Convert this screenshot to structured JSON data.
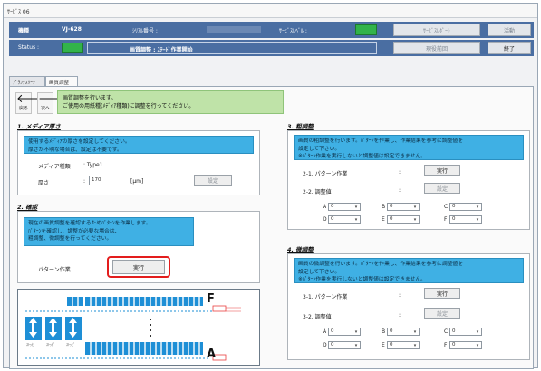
{
  "window": {
    "title": "ｻｰﾋﾞｽ 06"
  },
  "header": {
    "model_label": "機種",
    "model_value": "VJ-628",
    "serial_label": "ｼﾘｱﾙ番号 :",
    "service_level_label": "ｻｰﾋﾞｽﾚﾍﾞﾙ :",
    "status_label": "Status :",
    "status_text": "画質調整 : ｽﾃｰﾄﾞ作業開始",
    "btn_top1": "ｻｰﾋﾞｽﾚﾎﾟｰﾄ",
    "btn_top2": "活動",
    "btn_mid": "現役前回",
    "btn_end": "終了",
    "status_color": "#32b34a"
  },
  "tabs": [
    "ﾌﾞﾗﾝｸｽﾘｰﾂ",
    "画質調整"
  ],
  "nav": {
    "back_label": "戻る",
    "next_label": "次へ",
    "instruction_line1": "画質調整を行います。",
    "instruction_line2": "ご使用の用紙種(ﾒﾃﾞｨｱ種類)に調整を行ってください。"
  },
  "section1": {
    "title": "1. メディア厚さ",
    "info_line1": "使用するﾒﾃﾞｨｱの厚さを設定してください。",
    "info_line2": "厚さが不明な場合は、設定は不要です。",
    "media_type_label": "メディア種類",
    "media_type_value": ": Type1",
    "thickness_label": "厚さ",
    "thickness_value": "170",
    "thickness_unit": "[μm]",
    "set_button": "設定"
  },
  "section2": {
    "title": "2. 確認",
    "info_line1": "現在の画質調整を確認するためﾊﾟﾀｰﾝを作業します。",
    "info_line2": "ﾊﾟﾀｰﾝを確認し、調整が必要な場合は、",
    "info_line3": "粗調整、微調整を行ってください。",
    "pattern_label": "パターン作業",
    "run_button": "実行"
  },
  "section3": {
    "title": "3. 粗調整",
    "info_line1": "画質の粗調整を行います。ﾊﾟﾀｰﾝを作業し、作業結果を参考に調整値を",
    "info_line2": "設定して下さい。",
    "info_line3": "※ﾊﾟﾀｰﾝ作業を実行しないと調整値は設定できません。",
    "pattern_label": "2-1. パターン作業",
    "run_button": "実行",
    "adjust_label": "2-2. 調整値",
    "set_button": "設定",
    "grid_labels": [
      "A",
      "B",
      "C",
      "D",
      "E",
      "F"
    ],
    "grid_values": [
      "0",
      "0",
      "0",
      "0",
      "0",
      "0"
    ]
  },
  "section4": {
    "title": "4. 微調整",
    "info_line1": "画質の微調整を行います。ﾊﾟﾀｰﾝを作業し、作業結果を参考に調整値を",
    "info_line2": "設定して下さい。",
    "info_line3": "※ﾊﾟﾀｰﾝ作業を実行しないと調整値は設定できません。",
    "pattern_label": "3-1. パターン作業",
    "run_button": "実行",
    "adjust_label": "3-2. 調整値",
    "set_button": "設定",
    "grid_labels": [
      "A",
      "B",
      "C",
      "D",
      "E",
      "F"
    ],
    "grid_values": [
      "0",
      "0",
      "0",
      "0",
      "0",
      "0"
    ]
  },
  "preview": {
    "letter_top": "F",
    "letter_bottom": "A",
    "small_labels": [
      "ｽﾄｯﾋﾟ",
      "ｽﾄｯﾋﾟ",
      "ｽﾄｯﾋﾟ"
    ]
  }
}
